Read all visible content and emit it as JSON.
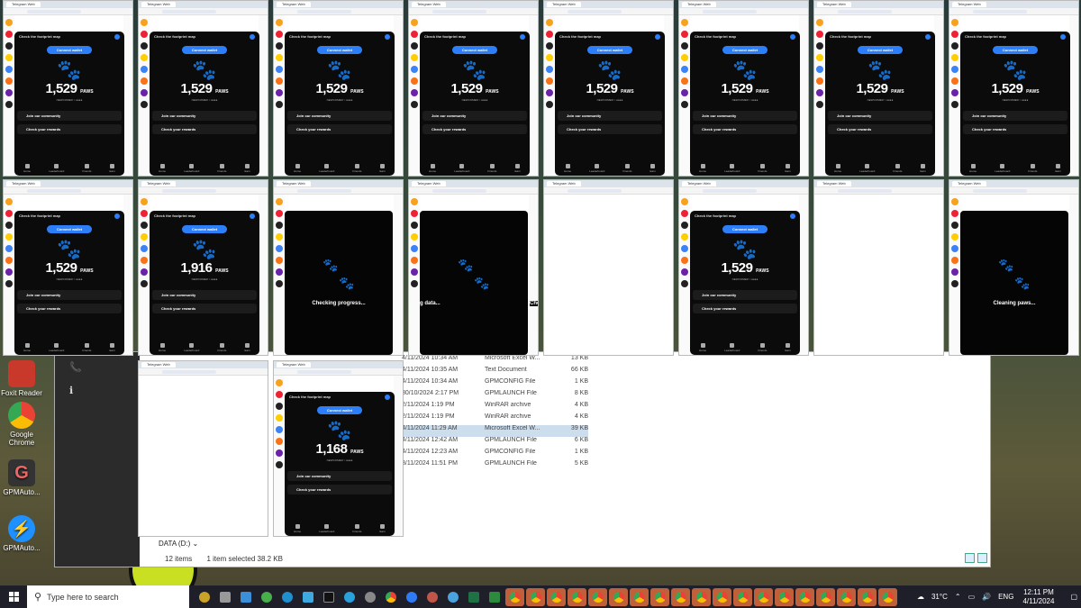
{
  "desktop": {
    "icons": [
      {
        "label": "Foxit Reader",
        "color": "#c8392b"
      },
      {
        "label": "Google Chrome",
        "color": "#ffffff"
      },
      {
        "label": "GPMAuto...",
        "color": "#333333"
      },
      {
        "label": "GPMAuto...",
        "color": "#1e90ff"
      }
    ]
  },
  "explorer": {
    "rows": [
      {
        "date": "4/11/2024 10:34 AM",
        "type": "Microsoft Excel W...",
        "size": "13 KB",
        "sel": false
      },
      {
        "date": "4/11/2024 10:35 AM",
        "type": "Text Document",
        "size": "66 KB",
        "sel": false
      },
      {
        "date": "4/11/2024 10:34 AM",
        "type": "GPMCONFIG File",
        "size": "1 KB",
        "sel": false
      },
      {
        "date": "30/10/2024 2:17 PM",
        "type": "GPMLAUNCH File",
        "size": "8 KB",
        "sel": false
      },
      {
        "date": "2/11/2024 1:19 PM",
        "type": "WinRAR archive",
        "size": "4 KB",
        "sel": false
      },
      {
        "date": "2/11/2024 1:19 PM",
        "type": "WinRAR archive",
        "size": "4 KB",
        "sel": false
      },
      {
        "date": "4/11/2024 11:29 AM",
        "type": "Microsoft Excel W...",
        "size": "39 KB",
        "sel": true
      },
      {
        "date": "4/11/2024 12:42 AM",
        "type": "GPMLAUNCH File",
        "size": "6 KB",
        "sel": false
      },
      {
        "date": "4/11/2024 12:23 AM",
        "type": "GPMCONFIG File",
        "size": "1 KB",
        "sel": false
      },
      {
        "date": "3/11/2024 11:51 PM",
        "type": "GPMLAUNCH File",
        "size": "5 KB",
        "sel": false
      }
    ],
    "drive": "DATA (D:)",
    "items": "12 items",
    "selected": "1 item selected  38.2 KB"
  },
  "paws": {
    "title": "Check the footprint map",
    "connect": "Connect wallet",
    "unit": "PAWS",
    "level": "NEWCOMER > ●●●●",
    "community": "Join our community",
    "rewards": "Check your rewards",
    "nav": [
      "Home",
      "Leaderboard",
      "Friends",
      "Earn"
    ],
    "balances": {
      "w1": "1,529",
      "w2": "1,529",
      "w3": "1,529",
      "w4": "1,529",
      "w5": "1,529",
      "w6": "1,529",
      "w7": "1,529",
      "w8": "1,529",
      "w9": "1,529",
      "w10": "1,916",
      "w14": "1,529",
      "w17": "1,168"
    },
    "loading": {
      "w11": "Checking progress...",
      "w12": "g data...",
      "w12b": "Checki",
      "w16": "Cleaning paws..."
    }
  },
  "taskbar": {
    "search_placeholder": "Type here to search",
    "temp": "31°C",
    "lang": "ENG",
    "time": "12:11 PM",
    "date": "4/11/2024"
  }
}
